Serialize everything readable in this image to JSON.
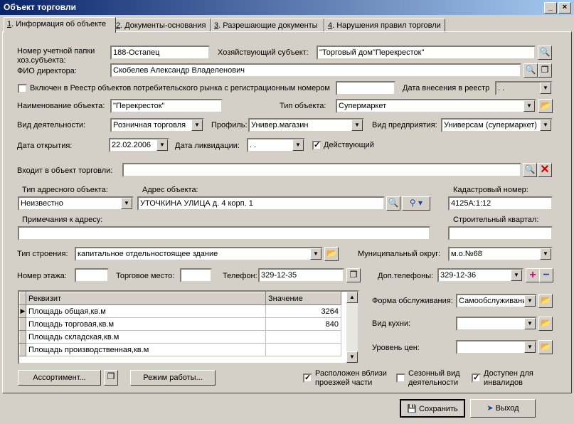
{
  "window": {
    "title": "Объект торговли",
    "min": "_",
    "close": "×"
  },
  "tabs": [
    {
      "key": "1",
      "label": ". Информация об объекте"
    },
    {
      "key": "2",
      "label": ". Документы-основания"
    },
    {
      "key": "3",
      "label": ". Разрешающие документы"
    },
    {
      "key": "4",
      "label": ". Нарушения правил торговли"
    }
  ],
  "form": {
    "account_label_1": "Номер учетной папки",
    "account_label_2": "хоз.субъекта:",
    "account_value": "188-Остапец",
    "entity_label": "Хозяйствующий субъект:",
    "entity_value": "\"Торговый дом\"Перекресток\"",
    "director_label": "ФИО директора:",
    "director_value": "Скобелев Александр Владеленович",
    "registry_label": "Включен в Реестр объектов потребительского рынка с регистрационным номером",
    "registry_number": "",
    "registry_date_label": "Дата внесения в реестр",
    "registry_date": " .  .",
    "name_label": "Наименование объекта:",
    "name_value": "\"Перекресток\"",
    "type_label": "Тип объекта:",
    "type_value": "Супермаркет",
    "activity_label": "Вид деятельности:",
    "activity_value": "Розничная торговля",
    "profile_label": "Профиль:",
    "profile_value": "Универ.магазин",
    "enterprise_label": "Вид предприятия:",
    "enterprise_value": "Универсам (супермаркет)",
    "open_date_label": "Дата открытия:",
    "open_date_value": "22.02.2006",
    "close_date_label": "Дата ликвидации:",
    "close_date_value": " .  .",
    "active_label": "Действующий",
    "part_of_label": "Входит в объект торговли:",
    "part_of_value": "",
    "addr_type_label": "Тип адресного объекта:",
    "addr_type_value": "Неизвестно",
    "address_label": "Адрес объекта:",
    "address_value": "УТОЧКИНА УЛИЦА д. 4 корп. 1",
    "cadastral_label": "Кадастровый номер:",
    "cadastral_value": "4125А:1:12",
    "addr_note_label": "Примечания к адресу:",
    "addr_note_value": "",
    "quarter_label": "Строительный квартал:",
    "quarter_value": "",
    "building_label": "Тип строения:",
    "building_value": "капитальное отдельностоящее здание",
    "district_label": "Муниципальный округ:",
    "district_value": "м.о.№68",
    "floor_label": "Номер этажа:",
    "floor_value": "",
    "place_label": "Торговое место:",
    "place_value": "",
    "phone_label": "Телефон:",
    "phone_value": "329-12-35",
    "extra_phone_label": "Доп.телефоны:",
    "extra_phone_value": "329-12-36",
    "service_label": "Форма обслуживания:",
    "service_value": "Самообслуживание",
    "cuisine_label": "Вид кухни:",
    "cuisine_value": "",
    "price_label": "Уровень цен:",
    "price_value": "",
    "near_roads_label_1": "Расположен вблизи",
    "near_roads_label_2": "проезжей части",
    "seasonal_label_1": "Сезонный вид",
    "seasonal_label_2": "деятельности",
    "disabled_label_1": "Доступен для",
    "disabled_label_2": "инвалидов"
  },
  "grid": {
    "col_requisite": "Реквизит",
    "col_value": "Значение",
    "rows": [
      {
        "name": "Площадь общая,кв.м",
        "value": "3264"
      },
      {
        "name": "Площадь торговая,кв.м",
        "value": "840"
      },
      {
        "name": "Площадь складская,кв.м",
        "value": ""
      },
      {
        "name": "Площадь производственная,кв.м",
        "value": ""
      }
    ]
  },
  "buttons": {
    "assortment": "Ассортимент...",
    "schedule": "Режим работы...",
    "save": "Сохранить",
    "exit": "Выход"
  }
}
